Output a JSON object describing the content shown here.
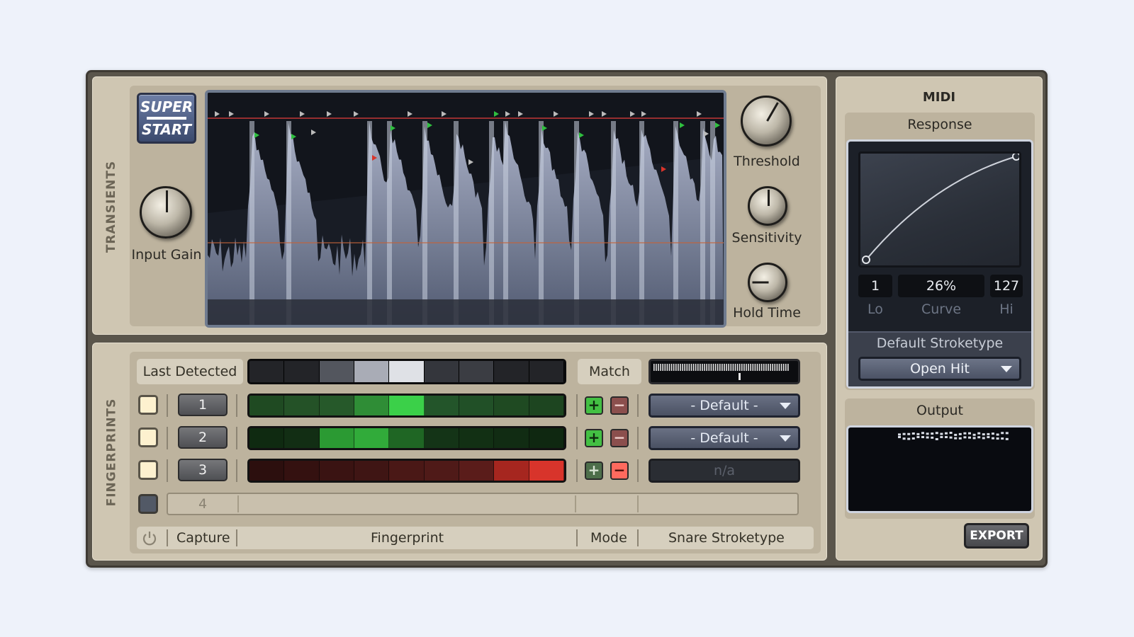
{
  "transients": {
    "section_label": "TRANSIENTS",
    "super_start": {
      "line1": "SUPER",
      "line2": "START"
    },
    "knobs": {
      "input_gain": "Input Gain",
      "threshold": "Threshold",
      "sensitivity": "Sensitivity",
      "hold_time": "Hold Time"
    }
  },
  "fingerprints": {
    "section_label": "FINGERPRINTS",
    "last_detected_label": "Last Detected",
    "match_label": "Match",
    "rows": [
      {
        "num": "1",
        "mode": "- Default -"
      },
      {
        "num": "2",
        "mode": "- Default -"
      },
      {
        "num": "3",
        "mode": "n/a"
      },
      {
        "num": "4"
      }
    ],
    "footer": {
      "capture": "Capture",
      "fingerprint": "Fingerprint",
      "mode": "Mode",
      "snare_stroketype": "Snare Stroketype"
    }
  },
  "midi": {
    "title": "MIDI",
    "response_label": "Response",
    "lo_value": "1",
    "curve_value": "26%",
    "hi_value": "127",
    "lo_label": "Lo",
    "curve_label": "Curve",
    "hi_label": "Hi",
    "default_stroketype_label": "Default Stroketype",
    "default_stroketype_value": "Open Hit",
    "output_label": "Output",
    "export_label": "EXPORT"
  },
  "colors": {
    "panel": "#cfc6b2",
    "green": "#2fbf3f",
    "red": "#d8342b"
  }
}
